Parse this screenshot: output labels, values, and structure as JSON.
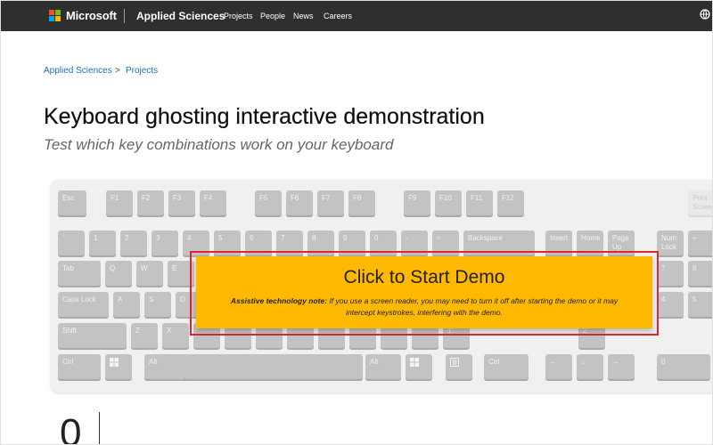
{
  "header": {
    "brand": "Microsoft",
    "site": "Applied Sciences",
    "nav": [
      "Projects",
      "People",
      "News",
      "Careers"
    ],
    "logo_colors": [
      "#f25022",
      "#7fba00",
      "#00a4ef",
      "#ffb900"
    ],
    "right_icon": "globe-icon"
  },
  "breadcrumb": {
    "items": [
      "Applied Sciences",
      "Projects"
    ],
    "separator": ">"
  },
  "page": {
    "title": "Keyboard ghosting interactive demonstration",
    "subtitle": "Test which key combinations work on your keyboard"
  },
  "demo": {
    "start_label": "Click to Start Demo",
    "note_label": "Assistive technology note:",
    "note_text": " If you use a screen reader, you may need to turn it off after starting the demo or it may intercept keystrokes, interfering with the demo.",
    "accent_color": "#ffb900",
    "highlight_color": "#e0262e"
  },
  "keyboard": {
    "rows": [
      {
        "name": "function-row",
        "keys": [
          {
            "label": "Esc",
            "icon": ""
          },
          {
            "label": "F1",
            "icon": ""
          },
          {
            "label": "F2",
            "icon": ""
          },
          {
            "label": "F3",
            "icon": ""
          },
          {
            "label": "F4",
            "icon": ""
          },
          {
            "label": "F5",
            "icon": ""
          },
          {
            "label": "F6",
            "icon": ""
          },
          {
            "label": "F7",
            "icon": ""
          },
          {
            "label": "F8",
            "icon": ""
          },
          {
            "label": "F9",
            "icon": ""
          },
          {
            "label": "F10",
            "icon": ""
          },
          {
            "label": "F11",
            "icon": ""
          },
          {
            "label": "F12",
            "icon": ""
          },
          {
            "label": "Print Screen",
            "icon": "",
            "faint": true
          }
        ]
      },
      {
        "name": "number-row",
        "keys": [
          {
            "label": "`",
            "icon": ""
          },
          {
            "label": "1",
            "icon": ""
          },
          {
            "label": "2",
            "icon": ""
          },
          {
            "label": "3",
            "icon": ""
          },
          {
            "label": "4",
            "icon": ""
          },
          {
            "label": "5",
            "icon": ""
          },
          {
            "label": "6",
            "icon": ""
          },
          {
            "label": "7",
            "icon": ""
          },
          {
            "label": "8",
            "icon": ""
          },
          {
            "label": "9",
            "icon": ""
          },
          {
            "label": "0",
            "icon": ""
          },
          {
            "label": "-",
            "icon": ""
          },
          {
            "label": "=",
            "icon": ""
          },
          {
            "label": "Backspace",
            "icon": ""
          },
          {
            "label": "Insert",
            "icon": ""
          },
          {
            "label": "Home",
            "icon": ""
          },
          {
            "label": "Page Up",
            "icon": ""
          },
          {
            "label": "Num Lock",
            "icon": ""
          },
          {
            "label": "÷",
            "icon": ""
          }
        ]
      },
      {
        "name": "tab-row",
        "keys": [
          {
            "label": "Tab",
            "icon": ""
          },
          {
            "label": "Q",
            "icon": ""
          },
          {
            "label": "W",
            "icon": ""
          },
          {
            "label": "E",
            "icon": ""
          },
          {
            "label": "7",
            "icon": ""
          },
          {
            "label": "8",
            "icon": ""
          }
        ]
      },
      {
        "name": "caps-row",
        "keys": [
          {
            "label": "Caps Lock",
            "icon": ""
          },
          {
            "label": "A",
            "icon": ""
          },
          {
            "label": "S",
            "icon": ""
          },
          {
            "label": "D",
            "icon": ""
          },
          {
            "label": "4",
            "icon": ""
          },
          {
            "label": "5",
            "icon": ""
          }
        ]
      },
      {
        "name": "shift-row",
        "keys": [
          {
            "label": "Shift",
            "icon": ""
          },
          {
            "label": "Z",
            "icon": ""
          },
          {
            "label": "X",
            "icon": ""
          },
          {
            "label": "",
            "icon": ""
          },
          {
            "label": "",
            "icon": ""
          },
          {
            "label": "",
            "icon": ""
          },
          {
            "label": "",
            "icon": ""
          },
          {
            "label": "",
            "icon": ""
          },
          {
            "label": "",
            "icon": ""
          },
          {
            "label": "",
            "icon": ""
          },
          {
            "label": "",
            "icon": ""
          },
          {
            "label": "1",
            "icon": ""
          },
          {
            "label": "2",
            "icon": ""
          }
        ]
      },
      {
        "name": "bottom-row",
        "keys": [
          {
            "label": "Ctrl",
            "icon": ""
          },
          {
            "label": "",
            "icon": "windows-icon"
          },
          {
            "label": "Alt",
            "icon": ""
          },
          {
            "label": "",
            "icon": ""
          },
          {
            "label": "Alt",
            "icon": ""
          },
          {
            "label": "",
            "icon": "windows-icon"
          },
          {
            "label": "",
            "icon": "menu-icon"
          },
          {
            "label": "Ctrl",
            "icon": ""
          },
          {
            "label": "←",
            "icon": ""
          },
          {
            "label": "↓",
            "icon": ""
          },
          {
            "label": "→",
            "icon": ""
          },
          {
            "label": "0",
            "icon": ""
          }
        ]
      }
    ]
  },
  "counter": {
    "value": "0"
  }
}
